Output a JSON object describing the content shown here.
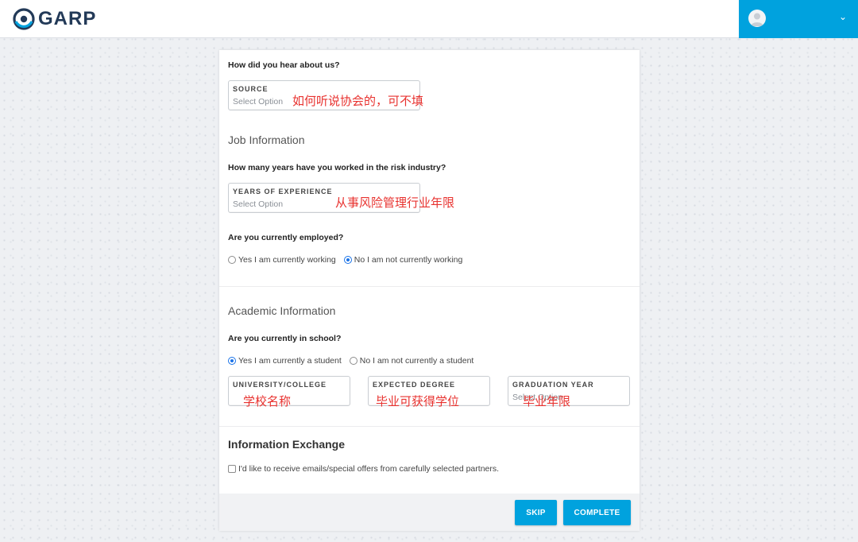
{
  "header": {
    "logo_text": "GARP",
    "menu_chevron": "⌄"
  },
  "source_section": {
    "question": "How did you hear about us?",
    "field_label": "SOURCE",
    "placeholder": "Select Option",
    "annotation": "如何听说协会的，可不填"
  },
  "job_section": {
    "title": "Job Information",
    "years_question": "How many years have you worked in the risk industry?",
    "years_label": "YEARS OF EXPERIENCE",
    "years_placeholder": "Select Option",
    "years_annotation": "从事风险管理行业年限",
    "employed_question": "Are you currently employed?",
    "employed_options": [
      {
        "label": "Yes I am currently working",
        "checked": false
      },
      {
        "label": "No I am not currently working",
        "checked": true
      }
    ]
  },
  "academic_section": {
    "title": "Academic Information",
    "school_question": "Are you currently in school?",
    "school_options": [
      {
        "label": "Yes I am currently a student",
        "checked": true
      },
      {
        "label": "No I am not currently a student",
        "checked": false
      }
    ],
    "fields": [
      {
        "label": "UNIVERSITY/COLLEGE",
        "placeholder": "",
        "annotation": "学校名称"
      },
      {
        "label": "EXPECTED DEGREE",
        "placeholder": "",
        "annotation": "毕业可获得学位"
      },
      {
        "label": "GRADUATION YEAR",
        "placeholder": "Select Option",
        "annotation": "毕业年限"
      }
    ]
  },
  "info_exchange": {
    "title": "Information Exchange",
    "checkbox_label": "I'd like to receive emails/special offers from carefully selected partners."
  },
  "footer": {
    "skip_label": "SKIP",
    "complete_label": "COMPLETE"
  },
  "colors": {
    "accent": "#00a2de",
    "annotation": "#e8322f",
    "brand_navy": "#233a58"
  }
}
